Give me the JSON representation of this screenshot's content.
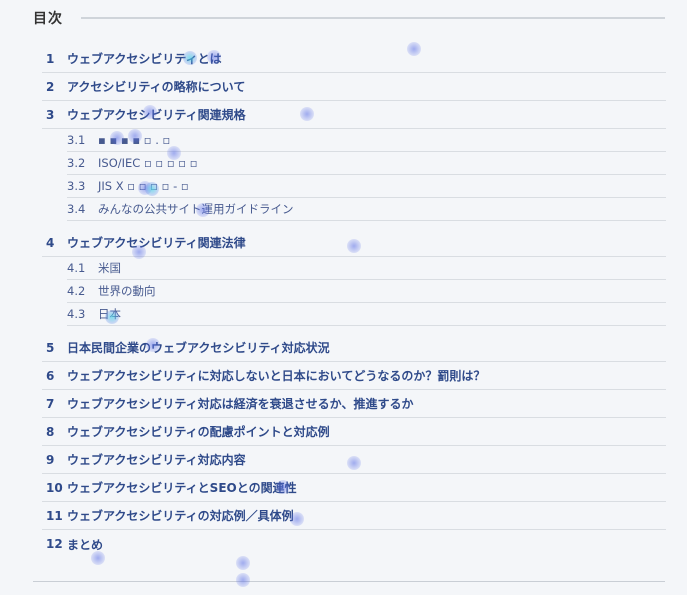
{
  "toc": {
    "title": "目次",
    "items": [
      {
        "num": "1",
        "label": "ウェブアクセシビリティとは"
      },
      {
        "num": "2",
        "label": "アクセシビリティの略称について"
      },
      {
        "num": "3",
        "label": "ウェブアクセシビリティ関連規格"
      },
      {
        "num": "3.1",
        "label": "▪ ▪ ▪ ▪ ▫ . ▫"
      },
      {
        "num": "3.2",
        "label": "ISO/IEC ▫ ▫ ▫ ▫ ▫"
      },
      {
        "num": "3.3",
        "label": "JIS X ▫ ▫ ▫ ▫ - ▫"
      },
      {
        "num": "3.4",
        "label": "みんなの公共サイト運用ガイドライン"
      },
      {
        "num": "4",
        "label": "ウェブアクセシビリティ関連法律"
      },
      {
        "num": "4.1",
        "label": "米国"
      },
      {
        "num": "4.2",
        "label": "世界の動向"
      },
      {
        "num": "4.3",
        "label": "日本"
      },
      {
        "num": "5",
        "label": "日本民間企業のウェブアクセシビリティ対応状況"
      },
      {
        "num": "6",
        "label": "ウェブアクセシビリティに対応しないと日本においてどうなるのか？罰則は？"
      },
      {
        "num": "7",
        "label": "ウェブアクセシビリティ対応は経済を衰退させるか、推進するか"
      },
      {
        "num": "8",
        "label": "ウェブアクセシビリティの配慮ポイントと対応例"
      },
      {
        "num": "9",
        "label": "ウェブアクセシビリティ対応内容"
      },
      {
        "num": "10",
        "label": "ウェブアクセシビリティとSEOとの関連性"
      },
      {
        "num": "11",
        "label": "ウェブアクセシビリティの対応例／具体例"
      },
      {
        "num": "12",
        "label": "まとめ"
      }
    ]
  },
  "colors": {
    "background": "#f4f6f9",
    "link": "#2f4a8a",
    "sublink": "#475a8f",
    "divider": "#d9dde2"
  }
}
